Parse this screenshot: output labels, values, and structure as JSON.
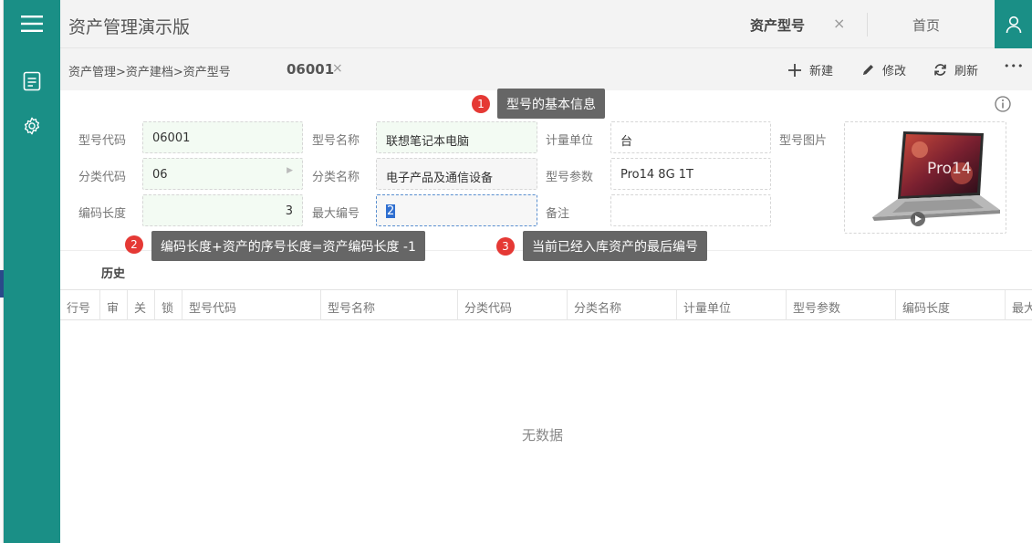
{
  "app": {
    "title": "资产管理演示版"
  },
  "tabs": {
    "active_label": "资产型号",
    "close_glyph": "×",
    "home_label": "首页"
  },
  "breadcrumb": {
    "path": "资产管理>资产建档>资产型号",
    "doc_id": "06001",
    "close_glyph": "×"
  },
  "toolbar": {
    "new_label": "新建",
    "edit_label": "修改",
    "refresh_label": "刷新",
    "more_glyph": "•••"
  },
  "form": {
    "model_code": {
      "label": "型号代码",
      "value": "06001"
    },
    "model_name": {
      "label": "型号名称",
      "value": "联想笔记本电脑"
    },
    "unit": {
      "label": "计量单位",
      "value": "台"
    },
    "model_image": {
      "label": "型号图片"
    },
    "category_code": {
      "label": "分类代码",
      "value": "06"
    },
    "category_name": {
      "label": "分类名称",
      "value": "电子产品及通信设备"
    },
    "model_params": {
      "label": "型号参数",
      "value": "Pro14 8G 1T"
    },
    "code_length": {
      "label": "编码长度",
      "value": "3"
    },
    "max_number": {
      "label": "最大编号",
      "value": "2"
    },
    "remark": {
      "label": "备注",
      "value": ""
    }
  },
  "annotations": [
    {
      "number": "1",
      "text": "型号的基本信息"
    },
    {
      "number": "2",
      "text": "编码长度+资产的序号长度=资产编码长度 -1"
    },
    {
      "number": "3",
      "text": "当前已经入库资产的最后编号"
    }
  ],
  "history": {
    "title": "历史",
    "columns": [
      "行号",
      "审",
      "关",
      "锁",
      "型号代码",
      "型号名称",
      "分类代码",
      "分类名称",
      "计量单位",
      "型号参数",
      "编码长度",
      "最大"
    ],
    "empty_text": "无数据"
  },
  "laptop_image": {
    "screen_text": "Pro14"
  },
  "colors": {
    "sidebar": "#1a8f86",
    "tooltip": "#666666",
    "badge": "#e53935",
    "field_green": "#f3fbf3"
  }
}
